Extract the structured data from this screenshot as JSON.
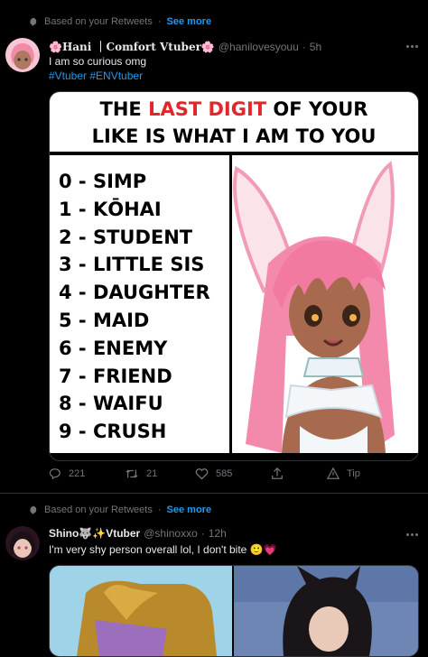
{
  "tweet1": {
    "context_label": "Based on your Retweets",
    "see_more": "See more",
    "name": "🌸Hani ｜Comfort Vtuber🌸",
    "handle": "@hanilovesyouu",
    "separator": "·",
    "time": "5h",
    "text": "I am so curious omg",
    "hashtags": "#Vtuber #ENVtuber",
    "meme": {
      "title_part1": "THE ",
      "title_red": "LAST DIGIT",
      "title_part2": " OF YOUR",
      "title_line2": "LIKE IS WHAT I AM TO YOU",
      "items": [
        "0 - SIMP",
        "1 - KŌHAI",
        "2 - STUDENT",
        "3 - LITTLE SIS",
        "4 - DAUGHTER",
        "5 - MAID",
        "6 - ENEMY",
        "7 - FRIEND",
        "8 - WAIFU",
        "9 - CRUSH"
      ]
    },
    "actions": {
      "replies": "221",
      "retweets": "21",
      "likes": "585",
      "tip": "Tip"
    }
  },
  "tweet2": {
    "context_label": "Based on your Retweets",
    "see_more": "See more",
    "name": "Shino🐺✨Vtuber",
    "handle": "@shinoxxo",
    "separator": "·",
    "time": "12h",
    "text": "I'm very shy person overall lol, I don't bite 🙂💗"
  },
  "colors": {
    "accent": "#1d9bf0",
    "muted": "#71767b",
    "meme_red": "#e3262b"
  }
}
